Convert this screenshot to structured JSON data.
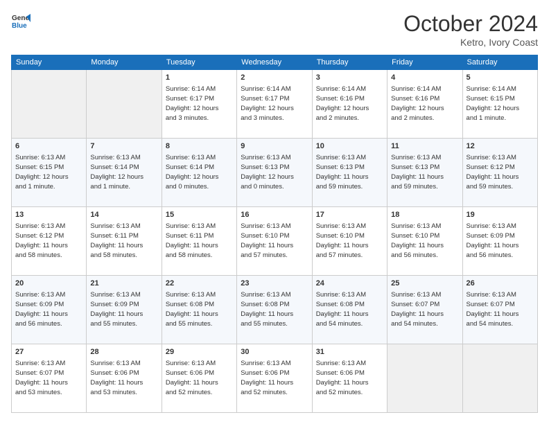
{
  "header": {
    "logo_general": "General",
    "logo_blue": "Blue",
    "month_title": "October 2024",
    "location": "Ketro, Ivory Coast"
  },
  "weekdays": [
    "Sunday",
    "Monday",
    "Tuesday",
    "Wednesday",
    "Thursday",
    "Friday",
    "Saturday"
  ],
  "weeks": [
    [
      {
        "day": "",
        "info": ""
      },
      {
        "day": "",
        "info": ""
      },
      {
        "day": "1",
        "info": "Sunrise: 6:14 AM\nSunset: 6:17 PM\nDaylight: 12 hours\nand 3 minutes."
      },
      {
        "day": "2",
        "info": "Sunrise: 6:14 AM\nSunset: 6:17 PM\nDaylight: 12 hours\nand 3 minutes."
      },
      {
        "day": "3",
        "info": "Sunrise: 6:14 AM\nSunset: 6:16 PM\nDaylight: 12 hours\nand 2 minutes."
      },
      {
        "day": "4",
        "info": "Sunrise: 6:14 AM\nSunset: 6:16 PM\nDaylight: 12 hours\nand 2 minutes."
      },
      {
        "day": "5",
        "info": "Sunrise: 6:14 AM\nSunset: 6:15 PM\nDaylight: 12 hours\nand 1 minute."
      }
    ],
    [
      {
        "day": "6",
        "info": "Sunrise: 6:13 AM\nSunset: 6:15 PM\nDaylight: 12 hours\nand 1 minute."
      },
      {
        "day": "7",
        "info": "Sunrise: 6:13 AM\nSunset: 6:14 PM\nDaylight: 12 hours\nand 1 minute."
      },
      {
        "day": "8",
        "info": "Sunrise: 6:13 AM\nSunset: 6:14 PM\nDaylight: 12 hours\nand 0 minutes."
      },
      {
        "day": "9",
        "info": "Sunrise: 6:13 AM\nSunset: 6:13 PM\nDaylight: 12 hours\nand 0 minutes."
      },
      {
        "day": "10",
        "info": "Sunrise: 6:13 AM\nSunset: 6:13 PM\nDaylight: 11 hours\nand 59 minutes."
      },
      {
        "day": "11",
        "info": "Sunrise: 6:13 AM\nSunset: 6:13 PM\nDaylight: 11 hours\nand 59 minutes."
      },
      {
        "day": "12",
        "info": "Sunrise: 6:13 AM\nSunset: 6:12 PM\nDaylight: 11 hours\nand 59 minutes."
      }
    ],
    [
      {
        "day": "13",
        "info": "Sunrise: 6:13 AM\nSunset: 6:12 PM\nDaylight: 11 hours\nand 58 minutes."
      },
      {
        "day": "14",
        "info": "Sunrise: 6:13 AM\nSunset: 6:11 PM\nDaylight: 11 hours\nand 58 minutes."
      },
      {
        "day": "15",
        "info": "Sunrise: 6:13 AM\nSunset: 6:11 PM\nDaylight: 11 hours\nand 58 minutes."
      },
      {
        "day": "16",
        "info": "Sunrise: 6:13 AM\nSunset: 6:10 PM\nDaylight: 11 hours\nand 57 minutes."
      },
      {
        "day": "17",
        "info": "Sunrise: 6:13 AM\nSunset: 6:10 PM\nDaylight: 11 hours\nand 57 minutes."
      },
      {
        "day": "18",
        "info": "Sunrise: 6:13 AM\nSunset: 6:10 PM\nDaylight: 11 hours\nand 56 minutes."
      },
      {
        "day": "19",
        "info": "Sunrise: 6:13 AM\nSunset: 6:09 PM\nDaylight: 11 hours\nand 56 minutes."
      }
    ],
    [
      {
        "day": "20",
        "info": "Sunrise: 6:13 AM\nSunset: 6:09 PM\nDaylight: 11 hours\nand 56 minutes."
      },
      {
        "day": "21",
        "info": "Sunrise: 6:13 AM\nSunset: 6:09 PM\nDaylight: 11 hours\nand 55 minutes."
      },
      {
        "day": "22",
        "info": "Sunrise: 6:13 AM\nSunset: 6:08 PM\nDaylight: 11 hours\nand 55 minutes."
      },
      {
        "day": "23",
        "info": "Sunrise: 6:13 AM\nSunset: 6:08 PM\nDaylight: 11 hours\nand 55 minutes."
      },
      {
        "day": "24",
        "info": "Sunrise: 6:13 AM\nSunset: 6:08 PM\nDaylight: 11 hours\nand 54 minutes."
      },
      {
        "day": "25",
        "info": "Sunrise: 6:13 AM\nSunset: 6:07 PM\nDaylight: 11 hours\nand 54 minutes."
      },
      {
        "day": "26",
        "info": "Sunrise: 6:13 AM\nSunset: 6:07 PM\nDaylight: 11 hours\nand 54 minutes."
      }
    ],
    [
      {
        "day": "27",
        "info": "Sunrise: 6:13 AM\nSunset: 6:07 PM\nDaylight: 11 hours\nand 53 minutes."
      },
      {
        "day": "28",
        "info": "Sunrise: 6:13 AM\nSunset: 6:06 PM\nDaylight: 11 hours\nand 53 minutes."
      },
      {
        "day": "29",
        "info": "Sunrise: 6:13 AM\nSunset: 6:06 PM\nDaylight: 11 hours\nand 52 minutes."
      },
      {
        "day": "30",
        "info": "Sunrise: 6:13 AM\nSunset: 6:06 PM\nDaylight: 11 hours\nand 52 minutes."
      },
      {
        "day": "31",
        "info": "Sunrise: 6:13 AM\nSunset: 6:06 PM\nDaylight: 11 hours\nand 52 minutes."
      },
      {
        "day": "",
        "info": ""
      },
      {
        "day": "",
        "info": ""
      }
    ]
  ]
}
